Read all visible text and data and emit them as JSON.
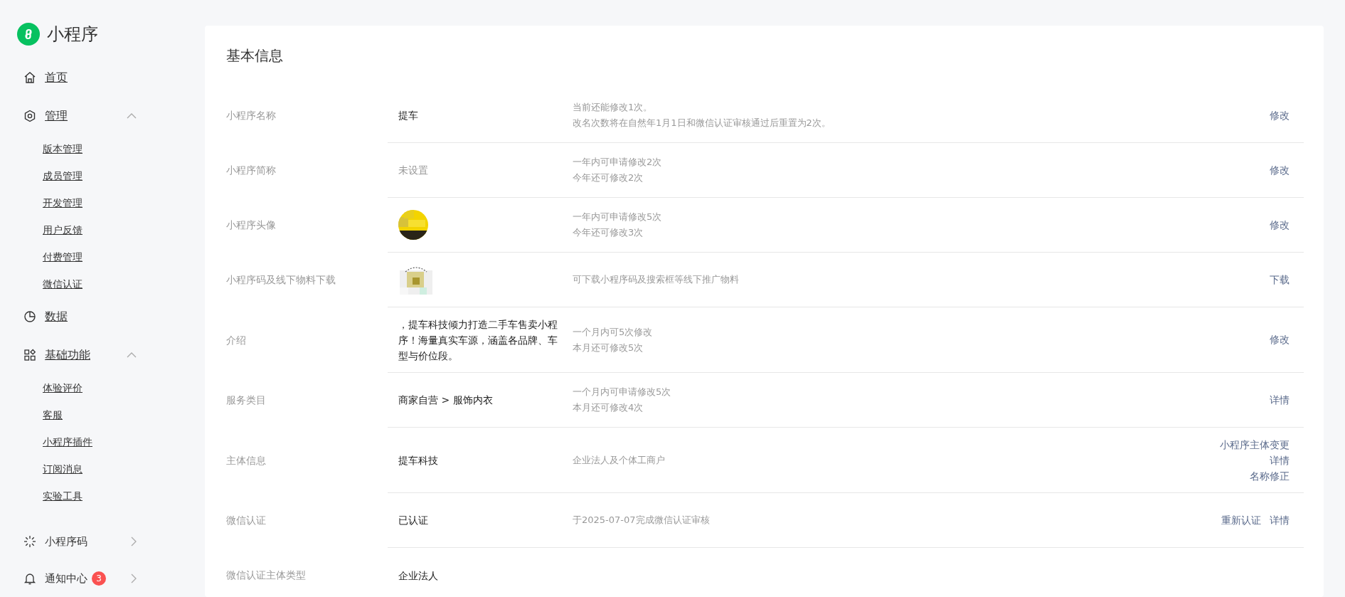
{
  "brand": {
    "title": "小程序"
  },
  "sidebar": {
    "items": [
      {
        "label": "首页"
      },
      {
        "label": "管理",
        "expanded": true,
        "children": [
          {
            "label": "版本管理"
          },
          {
            "label": "成员管理"
          },
          {
            "label": "开发管理"
          },
          {
            "label": "用户反馈"
          },
          {
            "label": "付费管理"
          },
          {
            "label": "微信认证"
          }
        ]
      },
      {
        "label": "数据"
      },
      {
        "label": "基础功能",
        "expanded": true,
        "children": [
          {
            "label": "体验评价"
          },
          {
            "label": "客服"
          },
          {
            "label": "小程序插件"
          },
          {
            "label": "订阅消息"
          },
          {
            "label": "实验工具"
          }
        ]
      }
    ],
    "bottom_items": [
      {
        "label": "小程序码"
      },
      {
        "label": "通知中心",
        "badge": "3"
      }
    ]
  },
  "section": {
    "title": "基本信息",
    "rows": [
      {
        "label": "小程序名称",
        "kind": "text",
        "value": "提车",
        "notes": [
          "当前还能修改1次。",
          "改名次数将在自然年1月1日和微信认证审核通过后重置为2次。"
        ],
        "actions": [
          "修改"
        ]
      },
      {
        "label": "小程序简称",
        "kind": "text",
        "value": "未设置",
        "muted": true,
        "notes": [
          "一年内可申请修改2次",
          "今年还可修改2次"
        ],
        "actions": [
          "修改"
        ]
      },
      {
        "label": "小程序头像",
        "kind": "avatar",
        "notes": [
          "一年内可申请修改5次",
          "今年还可修改3次"
        ],
        "actions": [
          "修改"
        ]
      },
      {
        "label": "小程序码及线下物料下载",
        "kind": "qrcode",
        "notes": [
          "可下载小程序码及搜索框等线下推广物料"
        ],
        "actions": [
          "下载"
        ]
      },
      {
        "label": "介绍",
        "kind": "text",
        "value": "，提车科技倾力打造二手车售卖小程序！海量真实车源，涵盖各品牌、车型与价位段。",
        "notes": [
          "一个月内可5次修改",
          "本月还可修改5次"
        ],
        "actions": [
          "修改"
        ]
      },
      {
        "label": "服务类目",
        "kind": "text",
        "value": "商家自营 > 服饰内衣",
        "notes": [
          "一个月内可申请修改5次",
          "本月还可修改4次"
        ],
        "actions": [
          "详情"
        ]
      },
      {
        "label": "主体信息",
        "kind": "text",
        "value": "提车科技",
        "notes": [
          "企业法人及个体工商户"
        ],
        "actions": [
          "小程序主体变更",
          "详情",
          "名称修正"
        ]
      },
      {
        "label": "微信认证",
        "kind": "text",
        "value": "已认证",
        "notes": [
          "于2025-07-07完成微信认证审核"
        ],
        "actions": [
          "重新认证",
          "详情"
        ]
      },
      {
        "label": "微信认证主体类型",
        "kind": "text",
        "value": "企业法人"
      }
    ]
  }
}
